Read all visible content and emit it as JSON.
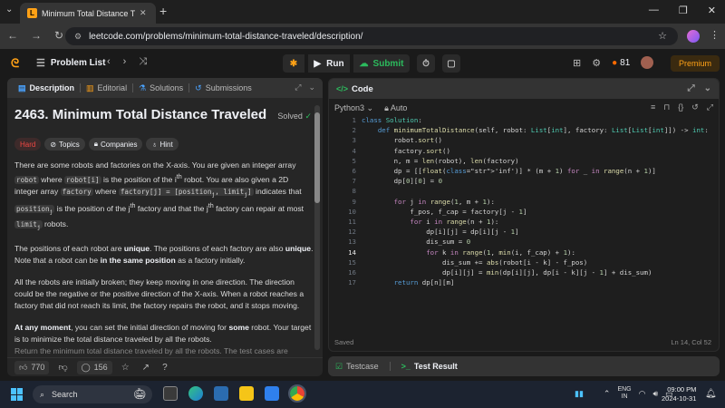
{
  "browser": {
    "tab_title": "Minimum Total Distance Travele",
    "url": "leetcode.com/problems/minimum-total-distance-traveled/description/"
  },
  "lc_nav": {
    "problem_list": "Problem List",
    "run": "Run",
    "submit": "Submit",
    "streak": "81",
    "premium": "Premium"
  },
  "left_tabs": [
    "Description",
    "Editorial",
    "Solutions",
    "Submissions"
  ],
  "problem": {
    "title": "2463. Minimum Total Distance Traveled",
    "solved": "Solved",
    "difficulty": "Hard",
    "tags": [
      "Topics",
      "Companies",
      "Hint"
    ],
    "para1_a": "There are some robots and factories on the X-axis. You are given an integer array ",
    "para1_code1": "robot",
    "para1_b": " where ",
    "para1_code2": "robot[i]",
    "para1_c": " is the position of the i",
    "para1_sup1": "th",
    "para1_d": " robot. You are also given a 2D integer array ",
    "para1_code3": "factory",
    "para1_e": " where ",
    "para1_code4": "factory[j] = [position",
    "para1_code4b": ", limit",
    "para1_code4c": "]",
    "para1_f": " indicates that ",
    "para1_code5": "position",
    "para1_g": " is the position of the j",
    "para1_h": " factory and that the j",
    "para1_i": " factory can repair at most ",
    "para1_code6": "limit",
    "para1_j": " robots.",
    "para2_a": "The positions of each robot are ",
    "para2_b1": "unique",
    "para2_c": ". The positions of each factory are also ",
    "para2_d": ". Note that a robot can be ",
    "para2_e": "in the same position",
    "para2_f": " as a factory initially.",
    "para3": "All the robots are initially broken; they keep moving in one direction. The direction could be the negative or the positive direction of the X-axis. When a robot reaches a factory that did not reach its limit, the factory repairs the robot, and it stops moving.",
    "para4_a": "At any moment",
    "para4_b": ", you can set the initial direction of moving for ",
    "para4_c": "some",
    "para4_d": " robot. Your target is to minimize the total distance traveled by all the robots.",
    "para5": "Return the minimum total distance traveled by all the robots. The test cases are",
    "likes": "770",
    "comments": "156"
  },
  "editor": {
    "header": "Code",
    "language": "Python3",
    "auto": "Auto",
    "saved": "Saved",
    "cursor": "Ln 14, Col 52",
    "lines": [
      "class Solution:",
      "    def minimumTotalDistance(self, robot: List[int], factory: List[List[int]]) -> int:",
      "        robot.sort()",
      "        factory.sort()",
      "        n, m = len(robot), len(factory)",
      "        dp = [[float('inf')] * (m + 1) for _ in range(n + 1)]",
      "        dp[0][0] = 0",
      "",
      "        for j in range(1, m + 1):",
      "            f_pos, f_cap = factory[j - 1]",
      "            for i in range(n + 1):",
      "                dp[i][j] = dp[i][j - 1]",
      "                dis_sum = 0",
      "                for k in range(1, min(i, f_cap) + 1):",
      "                    dis_sum += abs(robot[i - k] - f_pos)",
      "                    dp[i][j] = min(dp[i][j], dp[i - k][j - 1] + dis_sum)",
      "        return dp[n][m]"
    ],
    "line_numbers": [
      "1",
      "2",
      "3",
      "4",
      "5",
      "6",
      "7",
      "8",
      "9",
      "10",
      "11",
      "12",
      "13",
      "14",
      "15",
      "16",
      "17"
    ]
  },
  "bottom_tabs": [
    "Testcase",
    "Test Result"
  ],
  "taskbar": {
    "search": "Search",
    "lang1": "ENG",
    "lang2": "IN",
    "time": "09:00 PM",
    "date": "2024-10-31"
  }
}
